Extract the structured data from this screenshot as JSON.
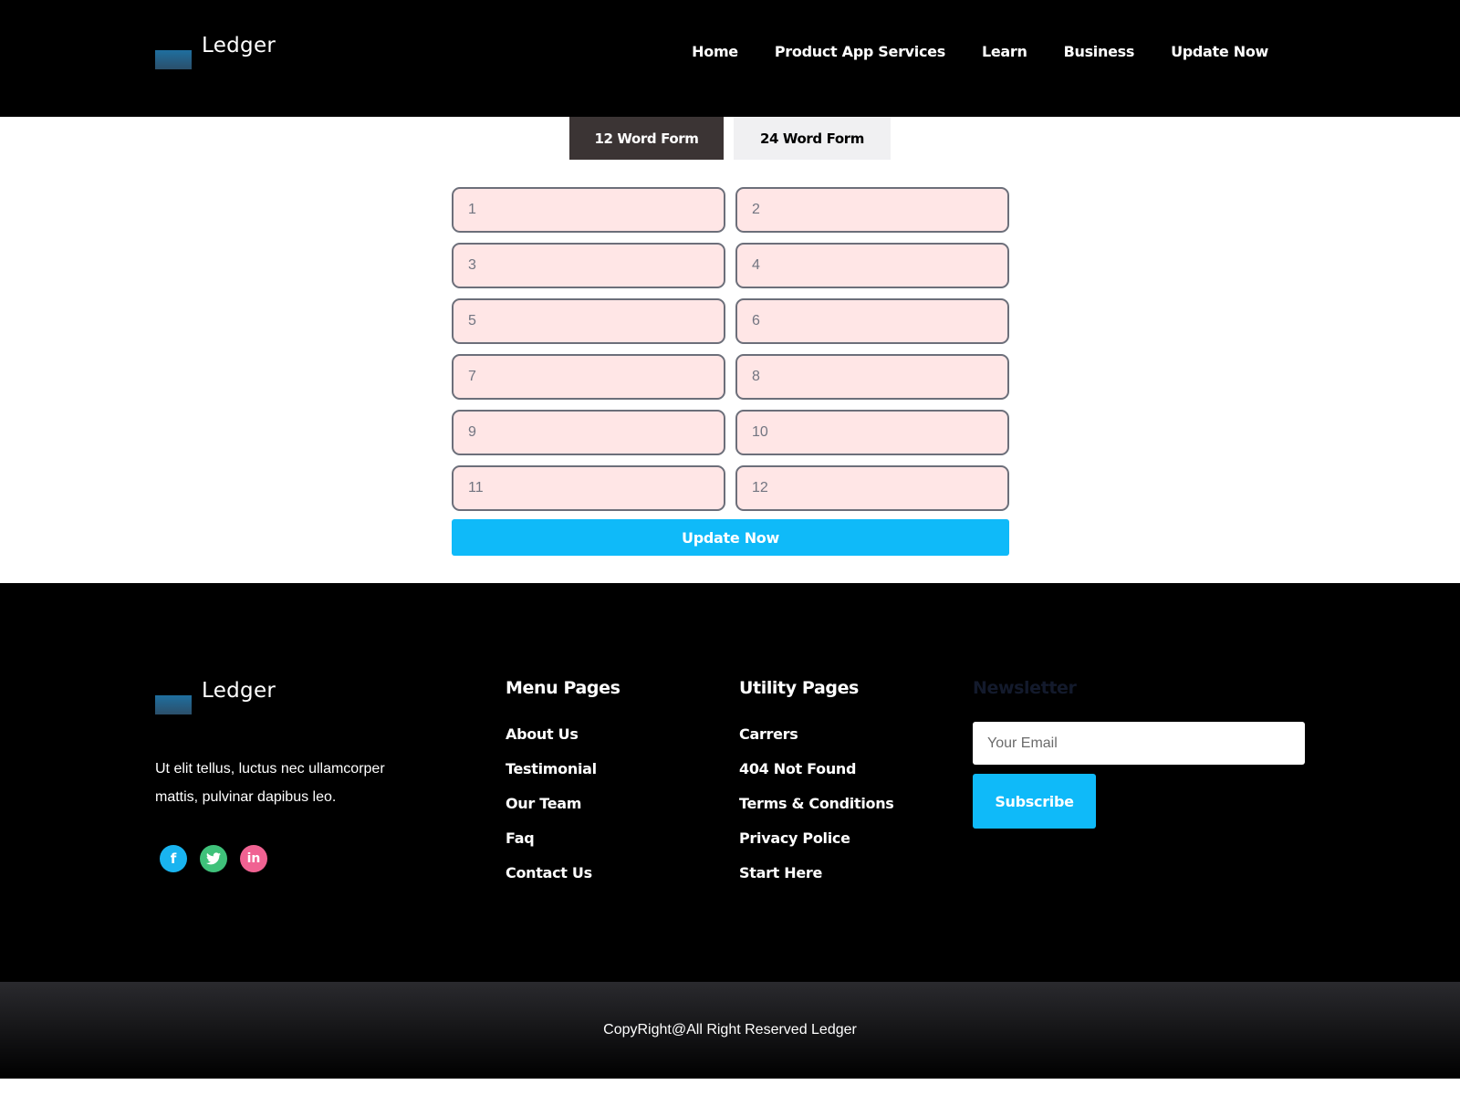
{
  "header": {
    "logo_text": "Ledger",
    "nav": [
      "Home",
      "Product App Services",
      "Learn",
      "Business",
      "Update Now"
    ]
  },
  "tabs": [
    "12 Word Form",
    "24 Word Form"
  ],
  "words": {
    "placeholders": [
      "1",
      "2",
      "3",
      "4",
      "5",
      "6",
      "7",
      "8",
      "9",
      "10",
      "11",
      "12"
    ],
    "update_label": "Update Now"
  },
  "footer": {
    "logo_text": "Ledger",
    "description": "Ut elit tellus, luctus nec ullamcorper mattis, pulvinar dapibus leo.",
    "menu_title": "Menu Pages",
    "menu_links": [
      "About Us",
      "Testimonial",
      "Our Team",
      "Faq",
      "Contact Us"
    ],
    "utility_title": "Utility Pages",
    "utility_links": [
      "Carrers",
      "404 Not Found",
      "Terms & Conditions",
      "Privacy Police",
      "Start Here"
    ],
    "newsletter_title": "Newsletter",
    "email_placeholder": "Your Email",
    "subscribe_label": "Subscribe"
  },
  "copyright": "CopyRight@All Right Reserved Ledger",
  "colors": {
    "accent": "#0fbaf9",
    "tab_active": "#3b3434",
    "input_bg": "#ffe6e6"
  },
  "icons": [
    "facebook-icon",
    "twitter-icon",
    "linkedin-icon"
  ]
}
